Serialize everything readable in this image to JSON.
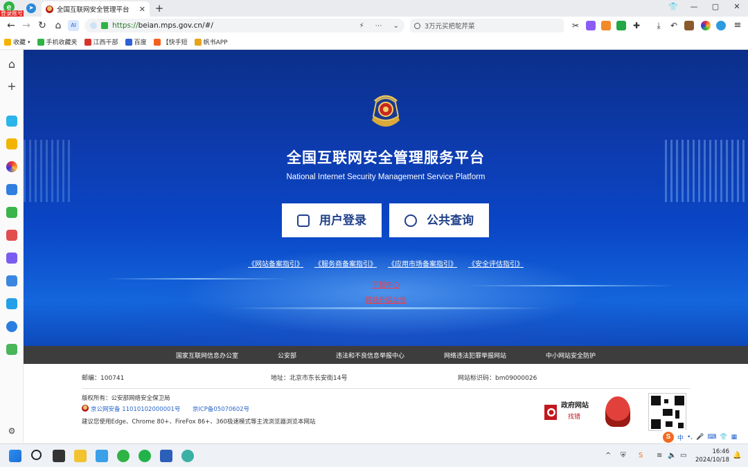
{
  "browser": {
    "app_badge_letter": "e",
    "app_badge_label": "登录账号",
    "tab_title": "全国互联网安全管理平台",
    "new_tab": "+",
    "address_scheme": "https://",
    "address_host": "beian.mps.gov.cn",
    "address_path": "/#/",
    "search_placeholder": "3万元买把鸵芹菜",
    "window_min": "—",
    "window_max": "▢",
    "window_close": "✕"
  },
  "bookmarks": [
    {
      "label": "收藏"
    },
    {
      "label": "手机收藏夹"
    },
    {
      "label": "江西干部"
    },
    {
      "label": "百度"
    },
    {
      "label": "【快手短"
    },
    {
      "label": "帆书APP"
    }
  ],
  "hero": {
    "title_cn": "全国互联网安全管理服务平台",
    "title_en": "National Internet Security Management Service Platform",
    "login_button": "用户登录",
    "query_button": "公共查询",
    "guides": [
      "《网站备案指引》",
      "《服务商备案指引》",
      "《应用市场备案指引》",
      "《安全评估指引》"
    ],
    "download_link": "下载中心",
    "notice_link": "网站升级公告"
  },
  "footer_nav": [
    "国家互联网信息办公室",
    "公安部",
    "违法和不良信息举报中心",
    "网络违法犯罪举报网站",
    "中小网站安全防护"
  ],
  "footer_info": {
    "postcode": "邮编：100741",
    "address": "地址：北京市东长安街14号",
    "site_id": "网站标识码：bm09000026",
    "copyright": "版权所有：公安部网络安全保卫局",
    "police_record": "京公网安备 11010102000001号",
    "icp_record": "京ICP备05070602号",
    "browser_hint": "建议您使用Edge、Chrome 80+、FireFox 86+、360极速模式等主流浏览器浏览本网站"
  },
  "footer_logos": {
    "gov_site_title": "政府网站",
    "gov_site_sub": "找错"
  },
  "ime": {
    "logo": "S",
    "mode": "中"
  },
  "taskbar": {
    "time": "16:46",
    "date": "2024/10/18"
  },
  "colors": {
    "hero_blue": "#0d3cb0",
    "button_text": "#1f3f8a",
    "footer_nav_bg": "#3d3d3d",
    "red_link": "#ff3a3a",
    "record_blue": "#2a66c9"
  }
}
